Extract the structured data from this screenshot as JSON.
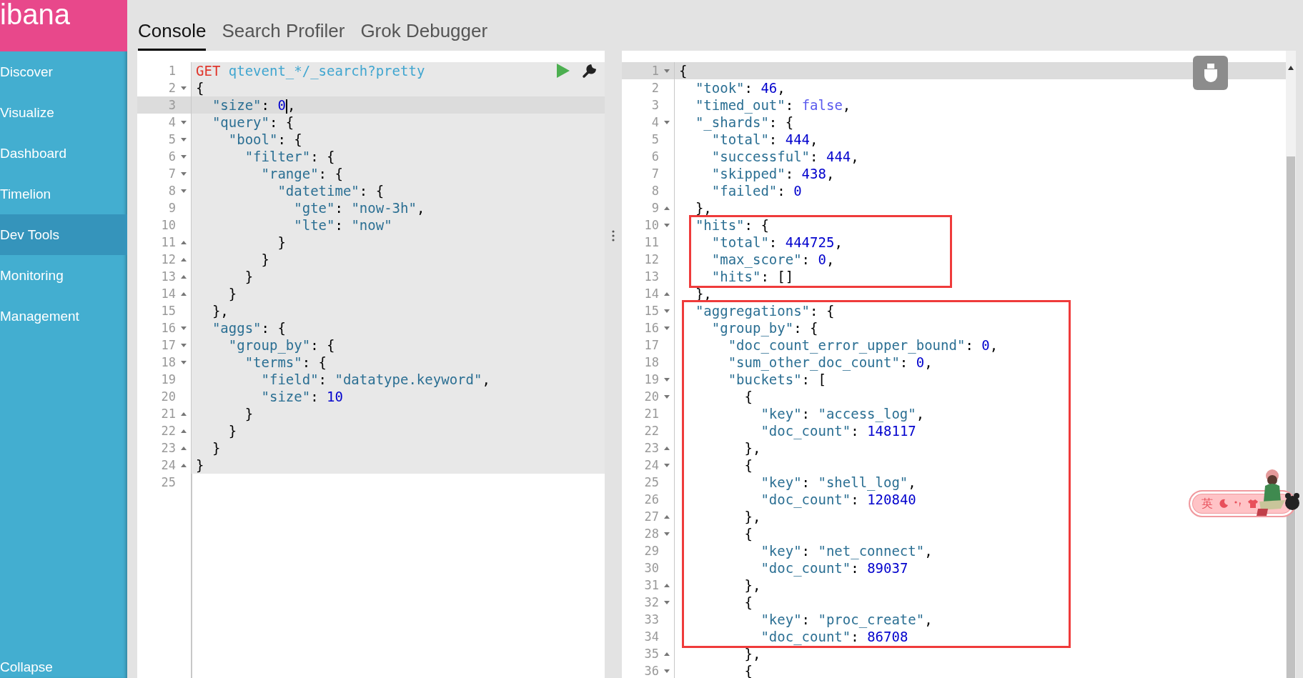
{
  "sidebar": {
    "logo": "ibana",
    "items": [
      {
        "label": "Discover",
        "selected": false
      },
      {
        "label": "Visualize",
        "selected": false
      },
      {
        "label": "Dashboard",
        "selected": false
      },
      {
        "label": "Timelion",
        "selected": false
      },
      {
        "label": "Dev Tools",
        "selected": true
      },
      {
        "label": "Monitoring",
        "selected": false
      },
      {
        "label": "Management",
        "selected": false
      }
    ],
    "collapse": "Collapse"
  },
  "tabs": [
    {
      "label": "Console",
      "selected": true
    },
    {
      "label": "Search Profiler",
      "selected": false
    },
    {
      "label": "Grok Debugger",
      "selected": false
    }
  ],
  "request_editor": {
    "lines": [
      {
        "number": "1",
        "kind": "request",
        "method": "GET",
        "path": "qtevent_*/_search?pretty",
        "fold_open": false,
        "fold_close": false,
        "in_request": true,
        "active": false
      },
      {
        "number": "2",
        "kind": "json",
        "text": "{",
        "fold_open": true,
        "fold_close": false,
        "in_request": true,
        "active": false
      },
      {
        "number": "3",
        "kind": "json",
        "text": "  \"size\": 0",
        "text_after_cursor": ",",
        "fold_open": false,
        "fold_close": false,
        "in_request": true,
        "active": true
      },
      {
        "number": "4",
        "kind": "json",
        "text": "  \"query\": {",
        "fold_open": true,
        "fold_close": false,
        "in_request": true,
        "active": false
      },
      {
        "number": "5",
        "kind": "json",
        "text": "    \"bool\": {",
        "fold_open": true,
        "fold_close": false,
        "in_request": true,
        "active": false
      },
      {
        "number": "6",
        "kind": "json",
        "text": "      \"filter\": {",
        "fold_open": true,
        "fold_close": false,
        "in_request": true,
        "active": false
      },
      {
        "number": "7",
        "kind": "json",
        "text": "        \"range\": {",
        "fold_open": true,
        "fold_close": false,
        "in_request": true,
        "active": false
      },
      {
        "number": "8",
        "kind": "json",
        "text": "          \"datetime\": {",
        "fold_open": true,
        "fold_close": false,
        "in_request": true,
        "active": false
      },
      {
        "number": "9",
        "kind": "json",
        "text": "            \"gte\": \"now-3h\",",
        "fold_open": false,
        "fold_close": false,
        "in_request": true,
        "active": false
      },
      {
        "number": "10",
        "kind": "json",
        "text": "            \"lte\": \"now\"",
        "fold_open": false,
        "fold_close": false,
        "in_request": true,
        "active": false
      },
      {
        "number": "11",
        "kind": "json",
        "text": "          }",
        "fold_open": false,
        "fold_close": true,
        "in_request": true,
        "active": false
      },
      {
        "number": "12",
        "kind": "json",
        "text": "        }",
        "fold_open": false,
        "fold_close": true,
        "in_request": true,
        "active": false
      },
      {
        "number": "13",
        "kind": "json",
        "text": "      }",
        "fold_open": false,
        "fold_close": true,
        "in_request": true,
        "active": false
      },
      {
        "number": "14",
        "kind": "json",
        "text": "    }",
        "fold_open": false,
        "fold_close": true,
        "in_request": true,
        "active": false
      },
      {
        "number": "15",
        "kind": "json",
        "text": "  },",
        "fold_open": false,
        "fold_close": false,
        "in_request": true,
        "active": false
      },
      {
        "number": "16",
        "kind": "json",
        "text": "  \"aggs\": {",
        "fold_open": true,
        "fold_close": false,
        "in_request": true,
        "active": false
      },
      {
        "number": "17",
        "kind": "json",
        "text": "    \"group_by\": {",
        "fold_open": true,
        "fold_close": false,
        "in_request": true,
        "active": false
      },
      {
        "number": "18",
        "kind": "json",
        "text": "      \"terms\": {",
        "fold_open": true,
        "fold_close": false,
        "in_request": true,
        "active": false
      },
      {
        "number": "19",
        "kind": "json",
        "text": "        \"field\": \"datatype.keyword\",",
        "fold_open": false,
        "fold_close": false,
        "in_request": true,
        "active": false
      },
      {
        "number": "20",
        "kind": "json",
        "text": "        \"size\": 10",
        "fold_open": false,
        "fold_close": false,
        "in_request": true,
        "active": false
      },
      {
        "number": "21",
        "kind": "json",
        "text": "      }",
        "fold_open": false,
        "fold_close": true,
        "in_request": true,
        "active": false
      },
      {
        "number": "22",
        "kind": "json",
        "text": "    }",
        "fold_open": false,
        "fold_close": true,
        "in_request": true,
        "active": false
      },
      {
        "number": "23",
        "kind": "json",
        "text": "  }",
        "fold_open": false,
        "fold_close": true,
        "in_request": true,
        "active": false
      },
      {
        "number": "24",
        "kind": "json",
        "text": "}",
        "fold_open": false,
        "fold_close": true,
        "in_request": true,
        "active": false
      },
      {
        "number": "25",
        "kind": "json",
        "fold_open": false,
        "fold_close": false,
        "in_request": false,
        "active": false
      }
    ]
  },
  "response_editor": {
    "lines": [
      {
        "number": "1",
        "text": "{",
        "fold_open": true,
        "fold_close": false,
        "active": true
      },
      {
        "number": "2",
        "text": "  \"took\": 46,",
        "fold_open": false,
        "fold_close": false,
        "active": false
      },
      {
        "number": "3",
        "text": "  \"timed_out\": false,",
        "fold_open": false,
        "fold_close": false,
        "active": false
      },
      {
        "number": "4",
        "text": "  \"_shards\": {",
        "fold_open": true,
        "fold_close": false,
        "active": false
      },
      {
        "number": "5",
        "text": "    \"total\": 444,",
        "fold_open": false,
        "fold_close": false,
        "active": false
      },
      {
        "number": "6",
        "text": "    \"successful\": 444,",
        "fold_open": false,
        "fold_close": false,
        "active": false
      },
      {
        "number": "7",
        "text": "    \"skipped\": 438,",
        "fold_open": false,
        "fold_close": false,
        "active": false
      },
      {
        "number": "8",
        "text": "    \"failed\": 0",
        "fold_open": false,
        "fold_close": false,
        "active": false
      },
      {
        "number": "9",
        "text": "  },",
        "fold_open": false,
        "fold_close": true,
        "active": false
      },
      {
        "number": "10",
        "text": "  \"hits\": {",
        "fold_open": true,
        "fold_close": false,
        "active": false
      },
      {
        "number": "11",
        "text": "    \"total\": 444725,",
        "fold_open": false,
        "fold_close": false,
        "active": false
      },
      {
        "number": "12",
        "text": "    \"max_score\": 0,",
        "fold_open": false,
        "fold_close": false,
        "active": false
      },
      {
        "number": "13",
        "text": "    \"hits\": []",
        "fold_open": false,
        "fold_close": false,
        "active": false
      },
      {
        "number": "14",
        "text": "  },",
        "fold_open": false,
        "fold_close": true,
        "active": false
      },
      {
        "number": "15",
        "text": "  \"aggregations\": {",
        "fold_open": true,
        "fold_close": false,
        "active": false
      },
      {
        "number": "16",
        "text": "    \"group_by\": {",
        "fold_open": true,
        "fold_close": false,
        "active": false
      },
      {
        "number": "17",
        "text": "      \"doc_count_error_upper_bound\": 0,",
        "fold_open": false,
        "fold_close": false,
        "active": false
      },
      {
        "number": "18",
        "text": "      \"sum_other_doc_count\": 0,",
        "fold_open": false,
        "fold_close": false,
        "active": false
      },
      {
        "number": "19",
        "text": "      \"buckets\": [",
        "fold_open": true,
        "fold_close": false,
        "active": false
      },
      {
        "number": "20",
        "text": "        {",
        "fold_open": true,
        "fold_close": false,
        "active": false
      },
      {
        "number": "21",
        "text": "          \"key\": \"access_log\",",
        "fold_open": false,
        "fold_close": false,
        "active": false
      },
      {
        "number": "22",
        "text": "          \"doc_count\": 148117",
        "fold_open": false,
        "fold_close": false,
        "active": false
      },
      {
        "number": "23",
        "text": "        },",
        "fold_open": false,
        "fold_close": true,
        "active": false
      },
      {
        "number": "24",
        "text": "        {",
        "fold_open": true,
        "fold_close": false,
        "active": false
      },
      {
        "number": "25",
        "text": "          \"key\": \"shell_log\",",
        "fold_open": false,
        "fold_close": false,
        "active": false
      },
      {
        "number": "26",
        "text": "          \"doc_count\": 120840",
        "fold_open": false,
        "fold_close": false,
        "active": false
      },
      {
        "number": "27",
        "text": "        },",
        "fold_open": false,
        "fold_close": true,
        "active": false
      },
      {
        "number": "28",
        "text": "        {",
        "fold_open": true,
        "fold_close": false,
        "active": false
      },
      {
        "number": "29",
        "text": "          \"key\": \"net_connect\",",
        "fold_open": false,
        "fold_close": false,
        "active": false
      },
      {
        "number": "30",
        "text": "          \"doc_count\": 89037",
        "fold_open": false,
        "fold_close": false,
        "active": false
      },
      {
        "number": "31",
        "text": "        },",
        "fold_open": false,
        "fold_close": true,
        "active": false
      },
      {
        "number": "32",
        "text": "        {",
        "fold_open": true,
        "fold_close": false,
        "active": false
      },
      {
        "number": "33",
        "text": "          \"key\": \"proc_create\",",
        "fold_open": false,
        "fold_close": false,
        "active": false
      },
      {
        "number": "34",
        "text": "          \"doc_count\": 86708",
        "fold_open": false,
        "fold_close": false,
        "active": false
      },
      {
        "number": "35",
        "text": "        },",
        "fold_open": false,
        "fold_close": true,
        "active": false
      },
      {
        "number": "36",
        "text": "        {",
        "fold_open": true,
        "fold_close": false,
        "active": false
      }
    ]
  },
  "annotation_boxes": [
    {
      "kind": "rectangle"
    },
    {
      "kind": "rectangle"
    }
  ],
  "ime_toolbar": {
    "mode": "英"
  }
}
